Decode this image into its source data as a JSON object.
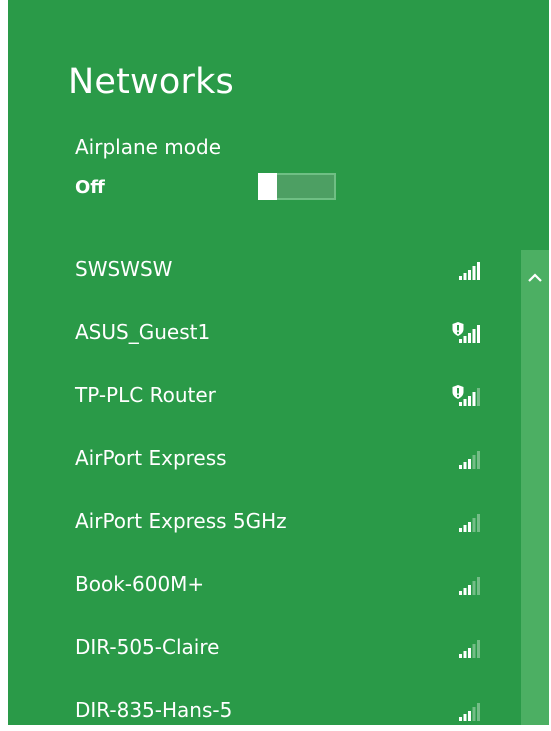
{
  "panel": {
    "title": "Networks",
    "background_color": "#2a9a48"
  },
  "airplane_mode": {
    "label": "Airplane mode",
    "state_label": "Off",
    "enabled": false
  },
  "networks": [
    {
      "name": "SWSWSW",
      "signal_bars": 5,
      "secured": true,
      "warning": false
    },
    {
      "name": "ASUS_Guest1",
      "signal_bars": 5,
      "secured": false,
      "warning": true
    },
    {
      "name": "TP-PLC Router",
      "signal_bars": 4,
      "secured": false,
      "warning": true
    },
    {
      "name": "AirPort Express",
      "signal_bars": 3,
      "secured": true,
      "warning": false
    },
    {
      "name": "AirPort Express 5GHz",
      "signal_bars": 3,
      "secured": true,
      "warning": false
    },
    {
      "name": "Book-600M+",
      "signal_bars": 3,
      "secured": true,
      "warning": false
    },
    {
      "name": "DIR-505-Claire",
      "signal_bars": 3,
      "secured": true,
      "warning": false
    },
    {
      "name": "DIR-835-Hans-5",
      "signal_bars": 3,
      "secured": true,
      "warning": false
    }
  ],
  "icons": {
    "signal": "wifi-signal-icon",
    "warning": "shield-warning-icon",
    "scroll_up": "chevron-up-icon"
  }
}
